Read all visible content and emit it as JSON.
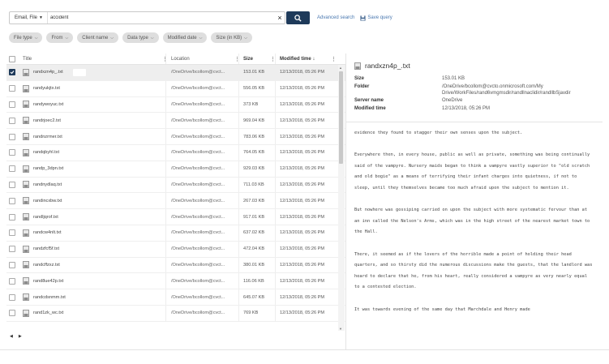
{
  "search": {
    "scope_label": "Email, File",
    "query": "accident",
    "advanced_label": "Advanced search",
    "save_label": "Save query"
  },
  "filters": [
    {
      "label": "File type"
    },
    {
      "label": "From"
    },
    {
      "label": "Client name"
    },
    {
      "label": "Data type"
    },
    {
      "label": "Modified date"
    },
    {
      "label": "Size (in KB)"
    }
  ],
  "table": {
    "headers": {
      "title": "Title",
      "location": "Location",
      "size": "Size",
      "modified": "Modified time ↓"
    },
    "rows": [
      {
        "title": "randxzn4p_.txt",
        "location": "/OneDrive/bcollom@cvct...",
        "size": "153.01 KB",
        "modified": "12/13/2018, 05:26 PM",
        "selected": true
      },
      {
        "title": "randyukjtx.txt",
        "location": "/OneDrive/bcollom@cvct...",
        "size": "556.05 KB",
        "modified": "12/13/2018, 05:26 PM"
      },
      {
        "title": "randywoyuc.txt",
        "location": "/OneDrive/bcollom@cvct...",
        "size": "373 KB",
        "modified": "12/13/2018, 05:26 PM"
      },
      {
        "title": "randrjoec2.txt",
        "location": "/OneDrive/bcollom@cvct...",
        "size": "969.04 KB",
        "modified": "12/13/2018, 05:26 PM"
      },
      {
        "title": "randnzrmer.txt",
        "location": "/OneDrive/bcollom@cvct...",
        "size": "783.06 KB",
        "modified": "12/13/2018, 05:26 PM"
      },
      {
        "title": "randqbyhl.txt",
        "location": "/OneDrive/bcollom@cvct...",
        "size": "764.05 KB",
        "modified": "12/13/2018, 05:26 PM"
      },
      {
        "title": "randp_3dpn.txt",
        "location": "/OneDrive/bcollom@cvct...",
        "size": "929.03 KB",
        "modified": "12/13/2018, 05:26 PM"
      },
      {
        "title": "randnydlaq.txt",
        "location": "/OneDrive/bcollom@cvct...",
        "size": "711.03 KB",
        "modified": "12/13/2018, 05:26 PM"
      },
      {
        "title": "randincxbw.txt",
        "location": "/OneDrive/bcollom@cvct...",
        "size": "267.03 KB",
        "modified": "12/13/2018, 05:26 PM"
      },
      {
        "title": "randljqrof.txt",
        "location": "/OneDrive/bcollom@cvct...",
        "size": "917.01 KB",
        "modified": "12/13/2018, 05:26 PM"
      },
      {
        "title": "randcw4nlt.txt",
        "location": "/OneDrive/bcollom@cvct...",
        "size": "637.02 KB",
        "modified": "12/13/2018, 05:26 PM"
      },
      {
        "title": "randzfcf5f.txt",
        "location": "/OneDrive/bcollom@cvct...",
        "size": "472.04 KB",
        "modified": "12/13/2018, 05:26 PM"
      },
      {
        "title": "randcffzxz.txt",
        "location": "/OneDrive/bcollom@cvct...",
        "size": "380.01 KB",
        "modified": "12/13/2018, 05:26 PM"
      },
      {
        "title": "rand8ue42p.txt",
        "location": "/OneDrive/bcollom@cvct...",
        "size": "116.06 KB",
        "modified": "12/13/2018, 05:26 PM"
      },
      {
        "title": "randcdsnmm.txt",
        "location": "/OneDrive/bcollom@cvct...",
        "size": "645.07 KB",
        "modified": "12/13/2018, 05:26 PM"
      },
      {
        "title": "rand1zk_wc.txt",
        "location": "/OneDrive/bcollom@cvct...",
        "size": "769 KB",
        "modified": "12/13/2018, 05:26 PM"
      }
    ]
  },
  "pager": {
    "prev": "◀",
    "next": "▶"
  },
  "preview": {
    "title": "randxzn4p_.txt",
    "meta": [
      {
        "key": "Size",
        "value": "153.01 KB"
      },
      {
        "key": "Folder",
        "value": "/OneDrive/bcollom@cvcto.onmicrosoft.com/My Drive/WorkFiles/rand6vmgmsdir/randllnaclidir/randllbSjavdir"
      },
      {
        "key": "Server name",
        "value": "OneDrive"
      },
      {
        "key": "Modified time",
        "value": "12/13/2018, 05:26 PM"
      }
    ],
    "paragraphs": [
      "evidence they found to stagger their own senses upon the subject.",
      "Everywhere then, in every house, public as well as private, something was being continually said of the vampyre. Nursery maids began to think a vampyre vastly superior to \"old scratch and old bogie\" as a means of terrifying their infant charges into quietness, if not to sleep, until they themselves became too much afraid upon the subject to mention it.",
      "But nowhere was gossiping carried on upon the subject with more systematic fervour than at an inn called the Nelson's Arms, which was in the high street of the nearest market town to the Hall.",
      "There, it seemed as if the lovers of the horrible made a point of holding their head quarters, and so thirsty did the numerous discussions make the guests, that the landlord was heard to declare that he, from his heart, really considered a vampyre as very nearly equal to a contested election.",
      "It was towards evening of the same day that Marchdale and Henry made"
    ]
  },
  "colors": {
    "primary": "#1e3a5a",
    "link": "#4a78b0",
    "chip": "#dedede",
    "selected_row": "#eeeeee"
  }
}
